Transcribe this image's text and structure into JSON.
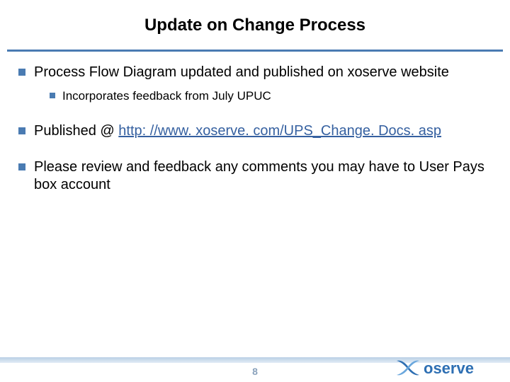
{
  "title": "Update on Change Process",
  "bullets": {
    "b1": {
      "text": "Process Flow Diagram updated and published on xoserve website",
      "sub1": "Incorporates feedback from July UPUC"
    },
    "b2": {
      "prefix": "Published @ ",
      "url": "http: //www. xoserve. com/UPS_Change. Docs. asp"
    },
    "b3": {
      "text": "Please review and feedback any comments you may have to User Pays box account"
    }
  },
  "page_number": "8",
  "logo_text": "oserve"
}
